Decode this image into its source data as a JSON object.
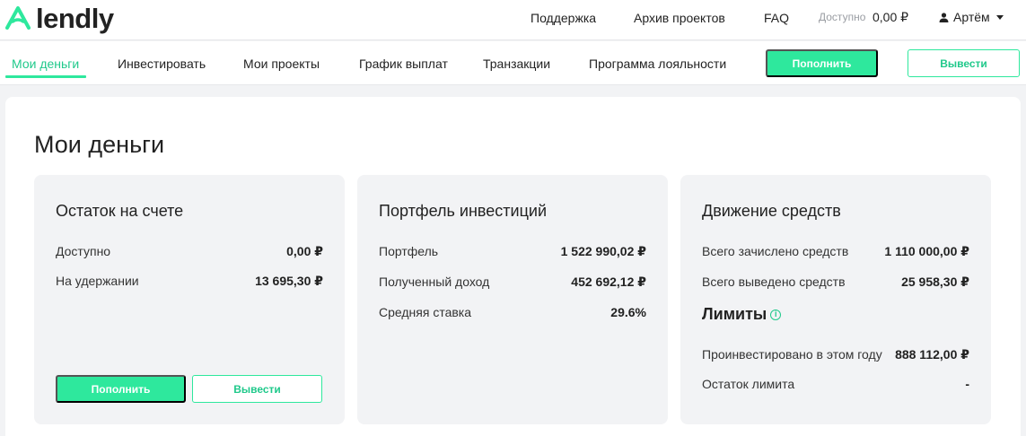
{
  "header": {
    "logo_text": "lendly",
    "links": [
      "Поддержка",
      "Архив проектов",
      "FAQ"
    ],
    "available_label": "Доступно",
    "available_value": "0,00 ₽",
    "user_name": "Артём"
  },
  "nav": {
    "items": [
      "Мои деньги",
      "Инвестировать",
      "Мои проекты",
      "График выплат",
      "Транзакции",
      "Программа лояльности"
    ],
    "active_index": 0,
    "deposit_label": "Пополнить",
    "withdraw_label": "Вывести"
  },
  "page": {
    "title": "Мои деньги"
  },
  "balance_card": {
    "title": "Остаток на счете",
    "rows": [
      {
        "label": "Доступно",
        "value": "0,00 ₽"
      },
      {
        "label": "На удержании",
        "value": "13 695,30 ₽"
      }
    ],
    "deposit_label": "Пополнить",
    "withdraw_label": "Вывести"
  },
  "portfolio_card": {
    "title": "Портфель инвестиций",
    "rows": [
      {
        "label": "Портфель",
        "value": "1 522 990,02 ₽"
      },
      {
        "label": "Полученный доход",
        "value": "452 692,12 ₽"
      },
      {
        "label": "Средняя ставка",
        "value": "29.6%"
      }
    ]
  },
  "flow_card": {
    "title": "Движение средств",
    "rows": [
      {
        "label": "Всего зачислено средств",
        "value": "1 110 000,00 ₽"
      },
      {
        "label": "Всего выведено средств",
        "value": "25 958,30 ₽"
      }
    ],
    "limits_title": "Лимиты",
    "limit_rows": [
      {
        "label": "Проинвестировано в этом году",
        "value": "888 112,00 ₽"
      },
      {
        "label": "Остаток лимита",
        "value": "-"
      }
    ]
  },
  "colors": {
    "accent": "#2ee89d",
    "accent_text": "#20c98b",
    "card_bg": "#f2f3f5"
  },
  "icons": [
    "lendly-logo-icon",
    "user-icon",
    "chevron-down-icon",
    "info-icon"
  ]
}
